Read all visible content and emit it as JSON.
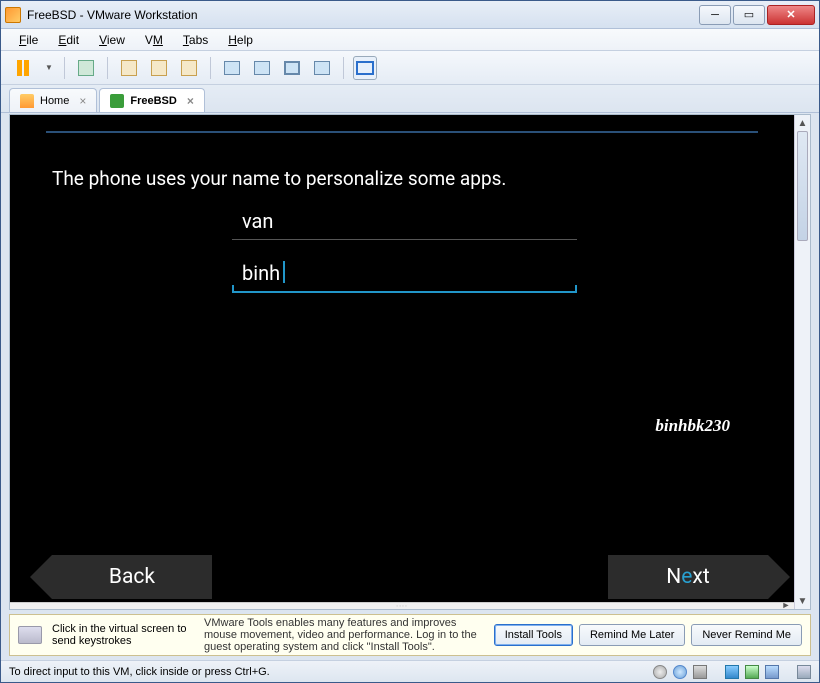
{
  "window": {
    "title": "FreeBSD - VMware Workstation"
  },
  "menu": {
    "file": "File",
    "edit": "Edit",
    "view": "View",
    "vm": "VM",
    "tabs": "Tabs",
    "help": "Help"
  },
  "tabs": {
    "home": "Home",
    "freebsd": "FreeBSD"
  },
  "guest": {
    "description": "The phone uses your name to personalize some apps.",
    "first_name": "van",
    "last_name": "binh",
    "watermark": "binhbk230",
    "back": "Back",
    "next_pre": "N",
    "next_post": "xt"
  },
  "hint": {
    "left": "Click in the virtual screen to send keystrokes",
    "right": "VMware Tools enables many features and improves mouse movement, video and performance. Log in to the guest operating system and click \"Install Tools\".",
    "install": "Install Tools",
    "remind": "Remind Me Later",
    "never": "Never Remind Me"
  },
  "status": {
    "text": "To direct input to this VM, click inside or press Ctrl+G."
  }
}
